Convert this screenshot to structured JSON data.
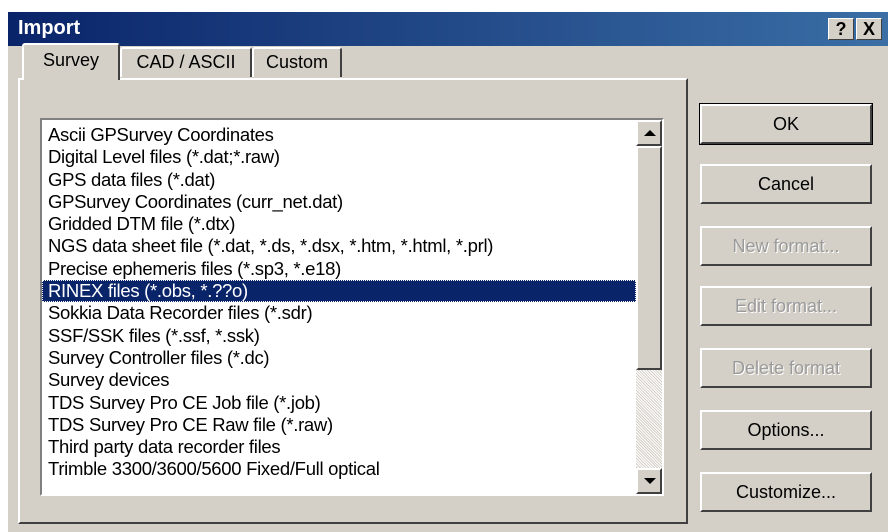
{
  "window": {
    "title": "Import",
    "help_label": "?",
    "close_label": "X"
  },
  "tabs": [
    {
      "label": "Survey",
      "active": true
    },
    {
      "label": "CAD / ASCII",
      "active": false
    },
    {
      "label": "Custom",
      "active": false
    }
  ],
  "formats": [
    "Ascii GPSurvey Coordinates",
    "Digital Level files (*.dat;*.raw)",
    "GPS data files (*.dat)",
    "GPSurvey Coordinates (curr_net.dat)",
    "Gridded DTM file (*.dtx)",
    "NGS data sheet file (*.dat, *.ds, *.dsx, *.htm, *.html, *.prl)",
    "Precise ephemeris files (*.sp3, *.e18)",
    "RINEX files (*.obs, *.??o)",
    "Sokkia Data Recorder files (*.sdr)",
    "SSF/SSK files (*.ssf, *.ssk)",
    "Survey Controller files (*.dc)",
    "Survey devices",
    "TDS Survey Pro CE Job file (*.job)",
    "TDS Survey Pro CE Raw file (*.raw)",
    "Third party data recorder files",
    "Trimble 3300/3600/5600 Fixed/Full optical"
  ],
  "selected_format": "RINEX files (*.obs, *.??o)",
  "buttons": {
    "ok": "OK",
    "cancel": "Cancel",
    "new_format": "New format...",
    "edit_format": "Edit format...",
    "delete_format": "Delete format",
    "options": "Options...",
    "customize": "Customize..."
  },
  "colors": {
    "titlebar_start": "#0a246a",
    "titlebar_end": "#3a6ea5",
    "selection": "#0a246a",
    "face": "#d4d0c8"
  }
}
